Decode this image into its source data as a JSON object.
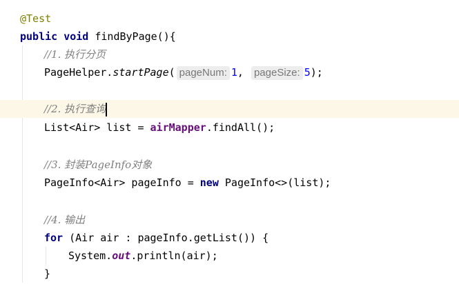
{
  "editor": {
    "lines": {
      "annotation": "@Test",
      "method_kw": "public",
      "method_type": "void",
      "method_sig": " findByPage(){",
      "comment1": "//1. 执行分页",
      "ph_class": "PageHelper.",
      "ph_method": "startPage",
      "ph_open": "(",
      "hint_pagenum": "pageNum:",
      "arg1": "1",
      "comma": ",",
      "hint_pagesize": "pageSize:",
      "arg2": "5",
      "ph_close": ");",
      "comment2": "//2. 执行查询",
      "list_decl": "List<Air> list = ",
      "list_field": "airMapper",
      "list_call": ".findAll();",
      "comment3": "//3. 封装PageInfo对象",
      "pi_decl": "PageInfo<Air> pageInfo = ",
      "pi_new": "new",
      "pi_rest": " PageInfo<>(list);",
      "comment4": "//4. 输出",
      "for_kw": "for",
      "for_rest": " (Air air : pageInfo.getList()) {",
      "sys_class": "System.",
      "sys_out": "out",
      "sys_call": ".println(air);",
      "close_brace": "}"
    }
  },
  "colors": {
    "keyword": "#000080",
    "annotation": "#808000",
    "comment": "#808080",
    "field": "#660e7a",
    "number": "#0000ff",
    "current_line": "#fcf7e6"
  }
}
